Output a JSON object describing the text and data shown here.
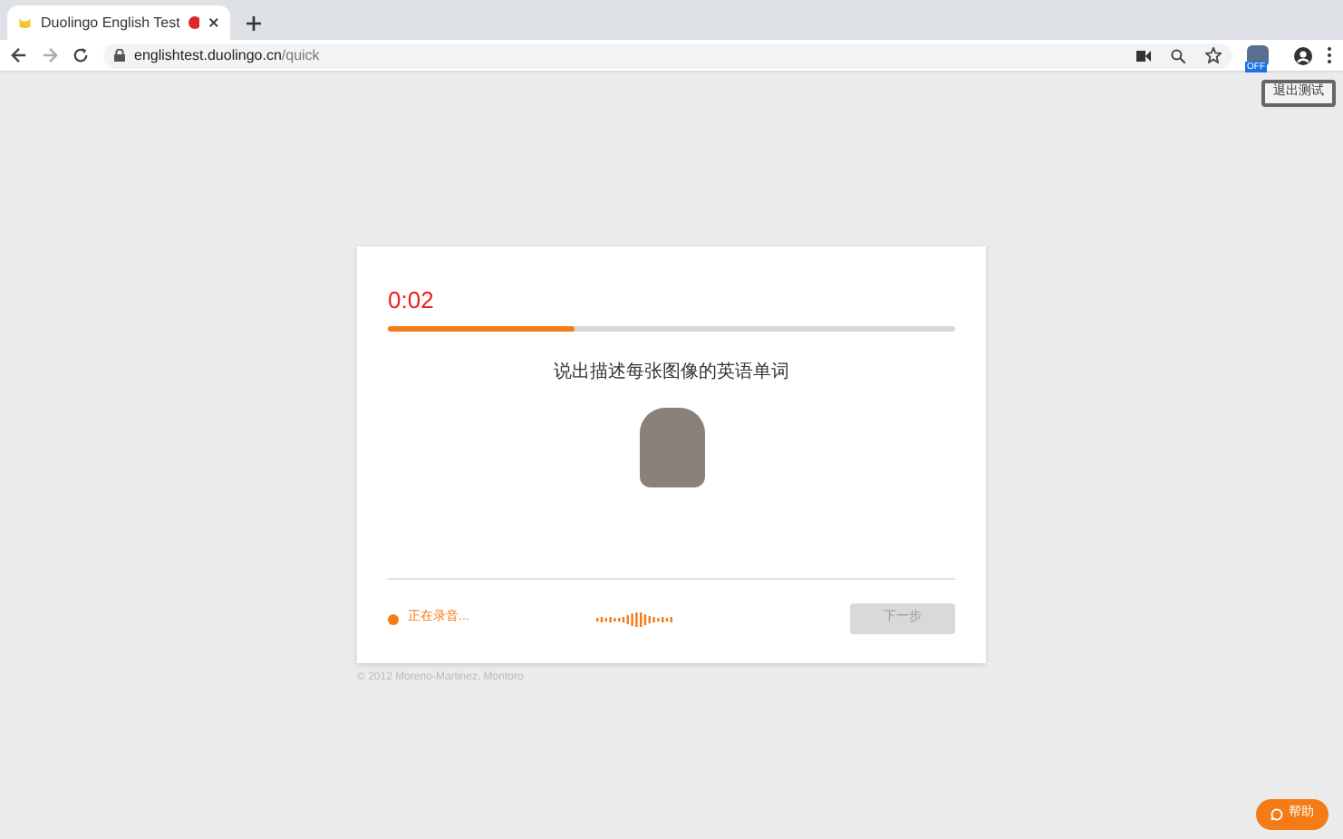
{
  "browser": {
    "tab": {
      "title": "Duolingo English Test",
      "recording": true
    },
    "url_host": "englishtest.duolingo.cn",
    "url_path": "/quick",
    "extension_badge": "OFF"
  },
  "exit_button": "退出测试",
  "card": {
    "timer": "0:02",
    "progress": {
      "level": 0.33
    },
    "prompt": "说出描述每张图像的英语单词",
    "status": "正在录音...",
    "recording": true,
    "next_button": {
      "label": "下一步",
      "disabled": true
    }
  },
  "footer": "© 2012 Moreno-Martinez, Montoro",
  "help_button": "帮助"
}
